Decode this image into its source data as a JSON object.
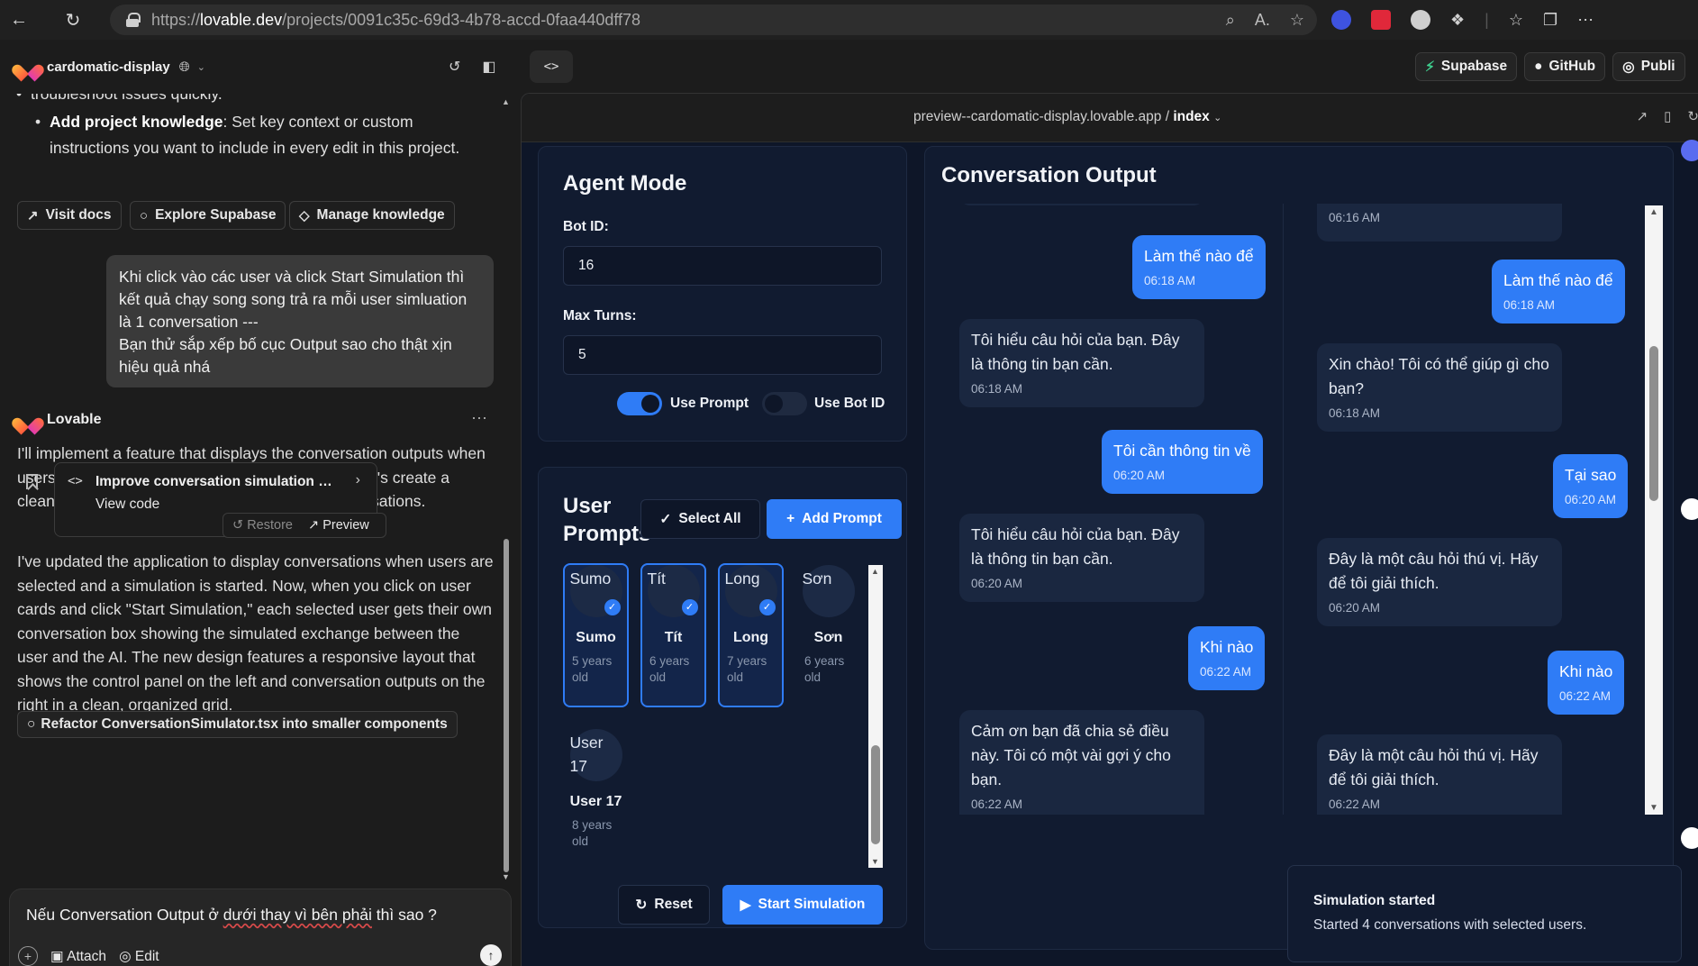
{
  "browser": {
    "url_prefix": "https://",
    "url_host": "lovable.dev",
    "url_path": "/projects/0091c35c-69d3-4b78-accd-0faa440dff78"
  },
  "project": {
    "name": "cardomatic-display"
  },
  "top_right": {
    "supabase": "Supabase",
    "github": "GitHub",
    "publish": "Publi"
  },
  "chat": {
    "bullet_partial": "troubleshoot issues quickly.",
    "bullet_bold": "Add project knowledge",
    "bullet_text": ": Set key context or custom instructions you want to include in every edit in this project.",
    "actions": [
      "Visit docs",
      "Explore Supabase",
      "Manage knowledge"
    ],
    "user_message": "Khi click vào các user và click Start Simulation thì kết quả chạy song song trả ra mỗi user simluation là 1 conversation ---\nBạn thử sắp xếp bố cục Output sao cho thật xịn hiệu quả nhá",
    "assistant_name": "Lovable",
    "ai_intro": "I'll implement a feature that displays the conversation outputs when users are selected and the simulation is started. Let's create a clean, organized layout for displaying these conversations.",
    "code_card": {
      "title": "Improve conversation simulation out...",
      "view": "View code"
    },
    "restore": "Restore",
    "preview": "Preview",
    "ai_summary": "I've updated the application to display conversations when users are selected and a simulation is started. Now, when you click on user cards and click \"Start Simulation,\" each selected user gets their own conversation box showing the simulated exchange between the user and the AI. The new design features a responsive layout that shows the control panel on the left and conversation outputs on the right in a clean, organized grid.",
    "suggestion": "Refactor ConversationSimulator.tsx into smaller components",
    "input_pre": "Nếu Conversation Output ở ",
    "input_err": "dưới thay vì bên phải",
    "input_post": " thì sao ?",
    "attach": "Attach",
    "edit": "Edit"
  },
  "preview_bar": {
    "host": "preview--cardomatic-display.lovable.app",
    "sep": " / ",
    "page": "index"
  },
  "agent": {
    "title": "Agent Mode",
    "bot_id_label": "Bot ID:",
    "bot_id_value": "16",
    "max_turns_label": "Max Turns:",
    "max_turns_value": "5",
    "use_prompt": "Use Prompt",
    "use_prompt_on": true,
    "use_bot_id": "Use Bot ID",
    "use_bot_id_on": false
  },
  "prompts": {
    "title_1": "User",
    "title_2": "Prompts",
    "select_all": "Select All",
    "add_prompt": "Add Prompt",
    "users": [
      {
        "alt": "Sumo",
        "name": "Sumo",
        "age": "5 years old",
        "selected": true
      },
      {
        "alt": "Tít",
        "name": "Tít",
        "age": "6 years old",
        "selected": true
      },
      {
        "alt": "Long",
        "name": "Long",
        "age": "7 years old",
        "selected": true
      },
      {
        "alt": "Sơn",
        "name": "Sơn",
        "age": "6 years old",
        "selected": false
      },
      {
        "alt": "User 17",
        "name": "User 17",
        "age": "8 years old",
        "selected": false
      }
    ],
    "reset": "Reset",
    "start": "Start Simulation"
  },
  "conversation": {
    "title": "Conversation Output",
    "col1": [
      {
        "role": "user",
        "text": "Làm thế nào để",
        "time": "06:18 AM"
      },
      {
        "role": "bot",
        "text": "Tôi hiểu câu hỏi của bạn. Đây là thông tin bạn cần.",
        "time": "06:18 AM"
      },
      {
        "role": "user",
        "text": "Tôi cần thông tin về",
        "time": "06:20 AM"
      },
      {
        "role": "bot",
        "text": "Tôi hiểu câu hỏi của bạn. Đây là thông tin bạn cần.",
        "time": "06:20 AM"
      },
      {
        "role": "user",
        "text": "Khi nào",
        "time": "06:22 AM"
      },
      {
        "role": "bot",
        "text": "Cảm ơn bạn đã chia sẻ điều này. Tôi có một vài gợi ý cho bạn.",
        "time": "06:22 AM"
      }
    ],
    "col2": [
      {
        "role": "bot",
        "text": "",
        "time": "06:16 AM"
      },
      {
        "role": "user",
        "text": "Làm thế nào để",
        "time": "06:18 AM"
      },
      {
        "role": "bot",
        "text": "Xin chào! Tôi có thể giúp gì cho bạn?",
        "time": "06:18 AM"
      },
      {
        "role": "user",
        "text": "Tại sao",
        "time": "06:20 AM"
      },
      {
        "role": "bot",
        "text": "Đây là một câu hỏi thú vị. Hãy để tôi giải thích.",
        "time": "06:20 AM"
      },
      {
        "role": "user",
        "text": "Khi nào",
        "time": "06:22 AM"
      },
      {
        "role": "bot",
        "text": "Đây là một câu hỏi thú vị. Hãy để tôi giải thích.",
        "time": "06:22 AM"
      }
    ]
  },
  "toast": {
    "title": "Simulation started",
    "desc": "Started 4 conversations with selected users."
  },
  "colors": {
    "accent": "#2f7cf6",
    "panel": "#111b30",
    "background": "#0e1628"
  }
}
